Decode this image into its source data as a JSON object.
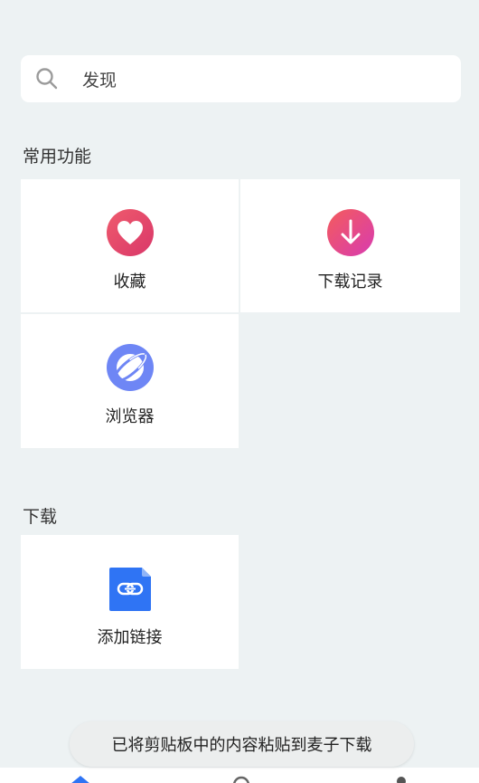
{
  "search": {
    "placeholder": "发现",
    "icon": "search-icon"
  },
  "sections": {
    "common_title": "常用功能",
    "download_title": "下载"
  },
  "common_tiles": [
    {
      "label": "收藏",
      "icon": "heart-icon",
      "color": "#e64a6a"
    },
    {
      "label": "下载记录",
      "icon": "download-arrow-icon",
      "color": "#ea4d8f"
    },
    {
      "label": "浏览器",
      "icon": "browser-planet-icon",
      "color": "#6e86f5"
    }
  ],
  "download_tiles": [
    {
      "label": "添加链接",
      "icon": "add-link-icon",
      "color": "#2f74f4"
    }
  ],
  "toast": {
    "message": "已将剪贴板中的内容粘贴到麦子下载"
  },
  "bottom_nav": {
    "icons": [
      "home-icon",
      "settings-icon",
      "profile-icon"
    ],
    "active_color": "#2f74f4"
  }
}
